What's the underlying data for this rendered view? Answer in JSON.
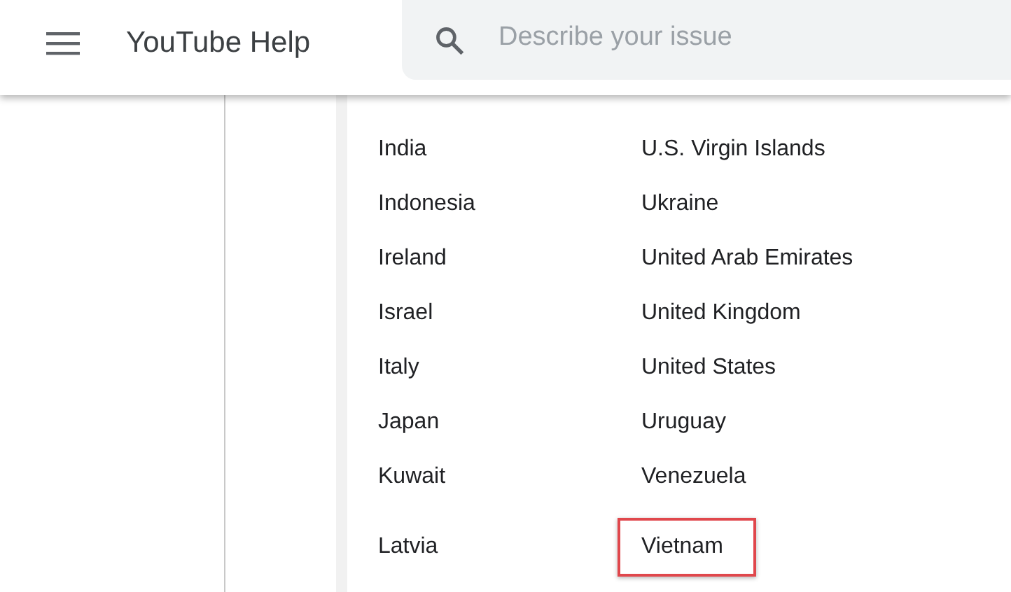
{
  "header": {
    "title": "YouTube Help",
    "search": {
      "placeholder": "Describe your issue"
    }
  },
  "countries": [
    {
      "left": {
        "label": "India",
        "highlighted": false
      },
      "right": {
        "label": "U.S. Virgin Islands",
        "highlighted": false
      }
    },
    {
      "left": {
        "label": "Indonesia",
        "highlighted": false
      },
      "right": {
        "label": "Ukraine",
        "highlighted": false
      }
    },
    {
      "left": {
        "label": "Ireland",
        "highlighted": false
      },
      "right": {
        "label": "United Arab Emirates",
        "highlighted": false
      }
    },
    {
      "left": {
        "label": "Israel",
        "highlighted": false
      },
      "right": {
        "label": "United Kingdom",
        "highlighted": false
      }
    },
    {
      "left": {
        "label": "Italy",
        "highlighted": false
      },
      "right": {
        "label": "United States",
        "highlighted": false
      }
    },
    {
      "left": {
        "label": "Japan",
        "highlighted": false
      },
      "right": {
        "label": "Uruguay",
        "highlighted": false
      }
    },
    {
      "left": {
        "label": "Kuwait",
        "highlighted": false
      },
      "right": {
        "label": "Venezuela",
        "highlighted": false
      }
    },
    {
      "left": {
        "label": "Latvia",
        "highlighted": false
      },
      "right": {
        "label": "Vietnam",
        "highlighted": true
      }
    }
  ]
}
